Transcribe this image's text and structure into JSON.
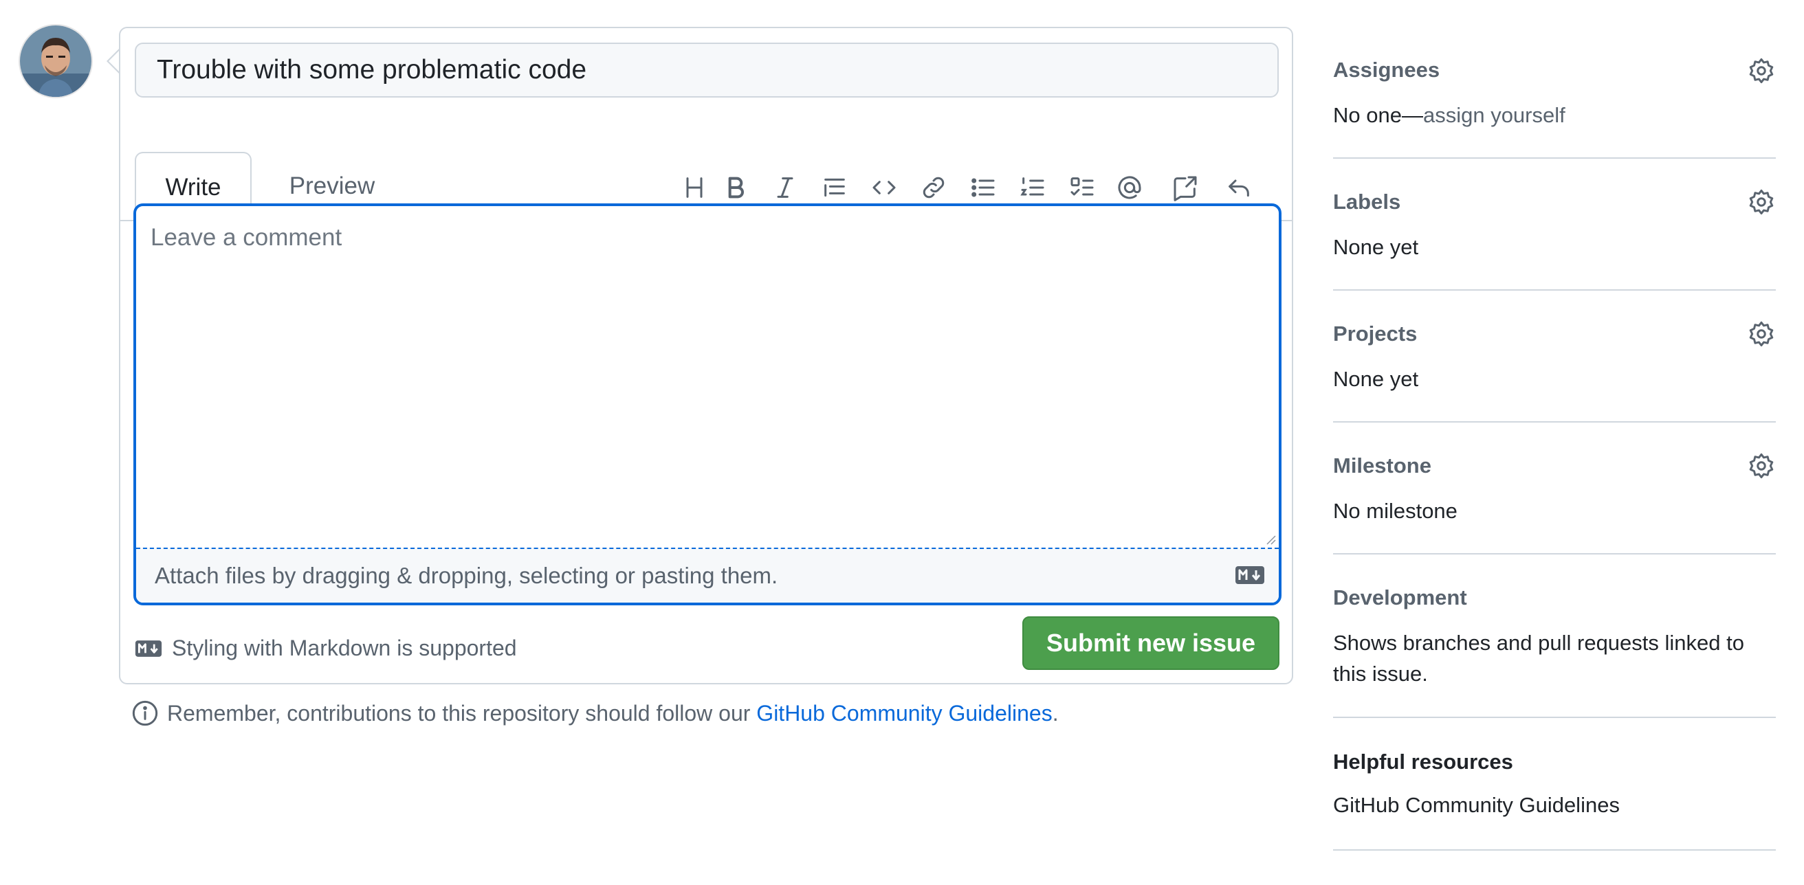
{
  "issue_form": {
    "title_value": "Trouble with some problematic code",
    "tabs": {
      "write": "Write",
      "preview": "Preview"
    },
    "toolbar_icons": [
      "heading-icon",
      "bold-icon",
      "italic-icon",
      "quote-icon",
      "code-icon",
      "link-icon",
      "bulleted-list-icon",
      "numbered-list-icon",
      "task-list-icon",
      "mention-icon",
      "cross-reference-icon",
      "saved-replies-icon"
    ],
    "comment_placeholder": "Leave a comment",
    "attach_text": "Attach files by dragging & dropping, selecting or pasting them.",
    "markdown_note": "Styling with Markdown is supported",
    "submit_label": "Submit new issue",
    "guidelines_prefix": "Remember, contributions to this repository should follow our",
    "guidelines_link": "GitHub Community Guidelines",
    "guidelines_suffix": "."
  },
  "sidebar": {
    "assignees": {
      "heading": "Assignees",
      "value_prefix": "No one—",
      "value_link": "assign yourself"
    },
    "labels": {
      "heading": "Labels",
      "value": "None yet"
    },
    "projects": {
      "heading": "Projects",
      "value": "None yet"
    },
    "milestone": {
      "heading": "Milestone",
      "value": "No milestone"
    },
    "development": {
      "heading": "Development",
      "value": "Shows branches and pull requests linked to this issue."
    },
    "helpful_resources": {
      "heading": "Helpful resources",
      "link": "GitHub Community Guidelines"
    }
  },
  "colors": {
    "accent_blue": "#0969da",
    "submit_green": "#4c9f4d",
    "muted_text": "#59636e",
    "border": "#d0d7de"
  }
}
